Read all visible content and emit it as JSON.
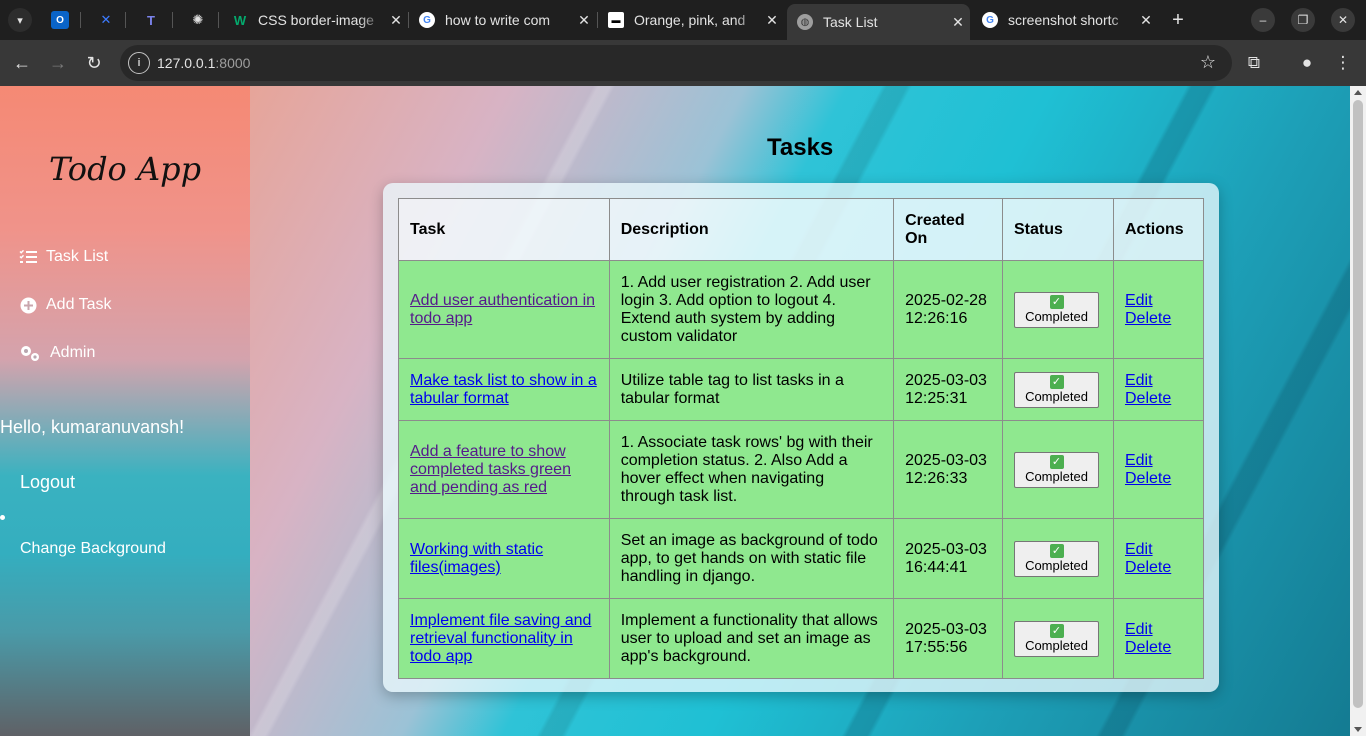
{
  "browser": {
    "tabs": [
      {
        "title": "CSS border-image",
        "favicon": "w3schools-icon",
        "color": "#04aa6d"
      },
      {
        "title": "how to write com",
        "favicon": "google-icon",
        "color": "#4285f4"
      },
      {
        "title": "Orange, pink, and",
        "favicon": "unsplash-icon",
        "color": "#ffffff"
      },
      {
        "title": "Task List",
        "favicon": "globe-icon",
        "color": "#9e9e9e",
        "active": true
      },
      {
        "title": "screenshot shortc",
        "favicon": "google-icon",
        "color": "#4285f4"
      }
    ],
    "url_host": "127.0.0.1",
    "url_port": ":8000"
  },
  "sidebar": {
    "logo": "Todo App",
    "nav": [
      {
        "label": "Task List",
        "icon": "list-icon"
      },
      {
        "label": "Add Task",
        "icon": "plus-circle-icon"
      },
      {
        "label": "Admin",
        "icon": "gears-icon"
      }
    ],
    "greeting": "Hello, kumaranuvansh!",
    "logout": "Logout",
    "change_background": "Change Background"
  },
  "main": {
    "title": "Tasks",
    "columns": [
      "Task",
      "Description",
      "Created On",
      "Status",
      "Actions"
    ],
    "status_icon": "✅",
    "edit_label": "Edit",
    "delete_label": "Delete",
    "rows": [
      {
        "task": "Add user authentication in todo app",
        "description": "1. Add user registration 2. Add user login 3. Add option to logout 4. Extend auth system by adding custom validator",
        "created_on": "2025-02-28 12:26:16",
        "status": "Completed"
      },
      {
        "task": "Make task list to show in a tabular format",
        "description": "Utilize table tag to list tasks in a tabular format",
        "created_on": "2025-03-03 12:25:31",
        "status": "Completed"
      },
      {
        "task": "Add a feature to show completed tasks green and pending as red",
        "description": "1. Associate task rows' bg with their completion status. 2. Also Add a hover effect when navigating through task list.",
        "created_on": "2025-03-03 12:26:33",
        "status": "Completed"
      },
      {
        "task": "Working with static files(images)",
        "description": "Set an image as background of todo app, to get hands on with static file handling in django.",
        "created_on": "2025-03-03 16:44:41",
        "status": "Completed"
      },
      {
        "task": "Implement file saving and retrieval functionality in todo app",
        "description": "Implement a functionality that allows user to upload and set an image as app's background.",
        "created_on": "2025-03-03 17:55:56",
        "status": "Completed"
      }
    ]
  },
  "colors": {
    "row_completed": "#8fe88f",
    "link": "#0000ee",
    "link_visited": "#551a8b"
  }
}
